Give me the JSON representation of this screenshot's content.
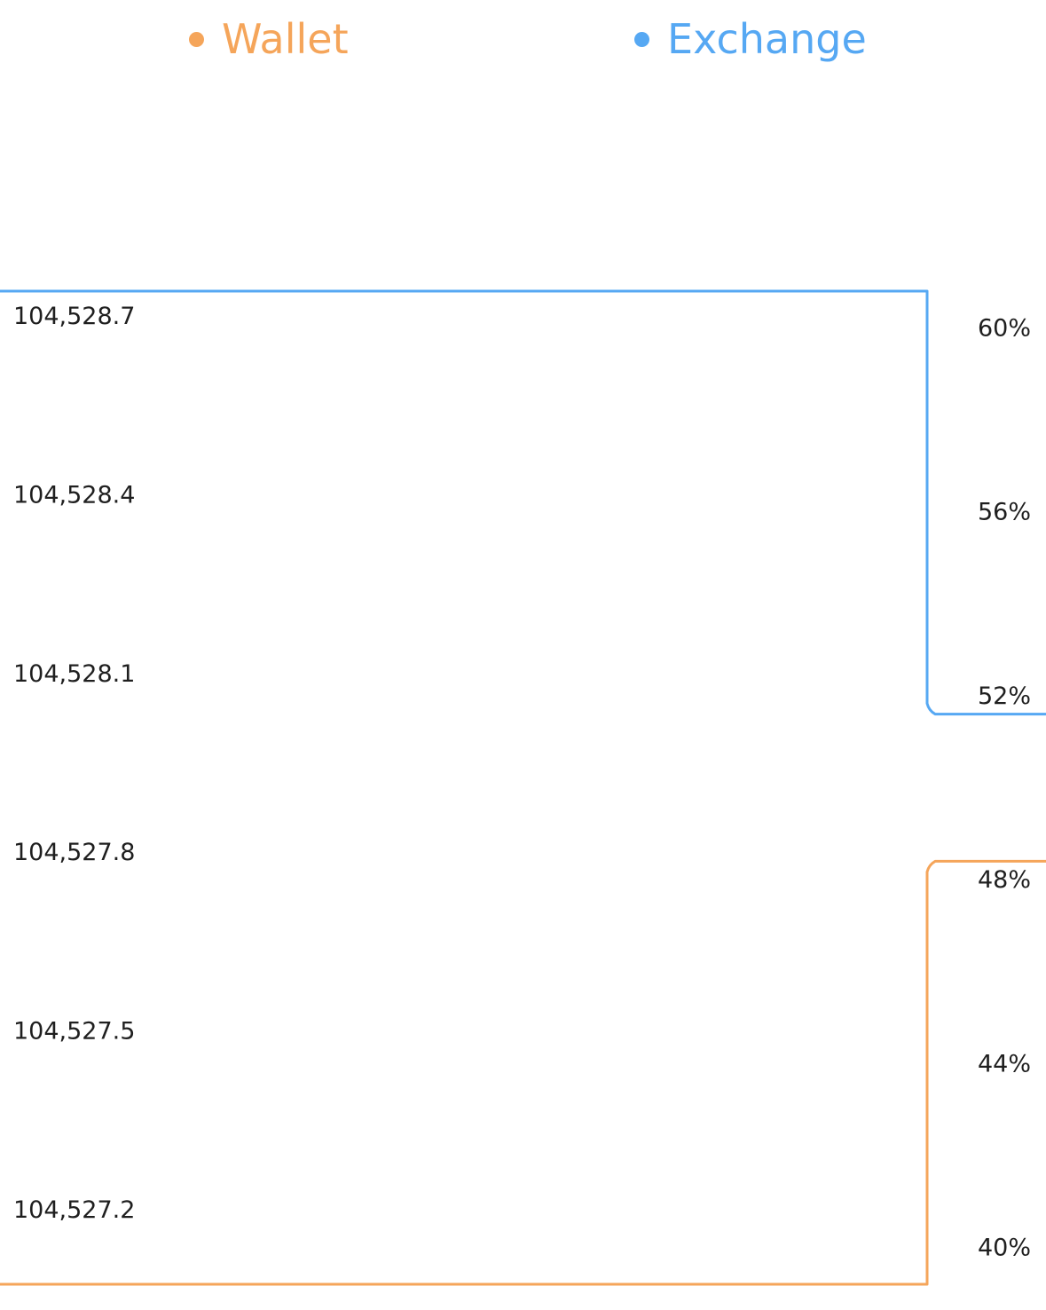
{
  "chart_data": {
    "type": "line",
    "legend_position": "top",
    "grid": false,
    "series": [
      {
        "name": "Wallet",
        "color": "#f5a55a",
        "axis": "right",
        "x": [
          0,
          10,
          20,
          30,
          40,
          50,
          60,
          70,
          80,
          90,
          100
        ],
        "values": [
          39.2,
          39.2,
          39.2,
          39.2,
          39.2,
          39.2,
          39.2,
          39.2,
          39.2,
          39.2,
          48.4
        ]
      },
      {
        "name": "Exchange",
        "color": "#56a8f3",
        "axis": "right",
        "x": [
          0,
          10,
          20,
          30,
          40,
          50,
          60,
          70,
          80,
          90,
          100
        ],
        "values": [
          60.8,
          60.8,
          60.8,
          60.8,
          60.8,
          60.8,
          60.8,
          60.8,
          60.8,
          60.8,
          51.6
        ]
      }
    ],
    "left_axis": {
      "ticks": [
        "104,528.7",
        "104,528.4",
        "104,528.1",
        "104,527.8",
        "104,527.5",
        "104,527.2"
      ]
    },
    "right_axis": {
      "ticks": [
        "60%",
        "56%",
        "52%",
        "48%",
        "44%",
        "40%"
      ],
      "ylim": [
        39.2,
        60.8
      ]
    }
  }
}
